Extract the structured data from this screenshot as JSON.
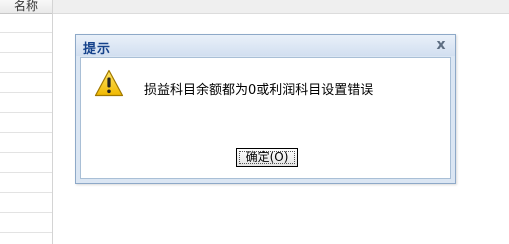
{
  "background": {
    "column_header": "名称"
  },
  "dialog": {
    "title": "提示",
    "close_icon": "close-icon",
    "close_symbol": "x",
    "icon": "warning-icon",
    "message": "损益科目余额都为0或利润科目设置错误",
    "ok_label": "确定(O)"
  },
  "colors": {
    "title_text": "#15428b",
    "dialog_frame": "#dbe6f3",
    "warning_fill": "#f5c400"
  }
}
